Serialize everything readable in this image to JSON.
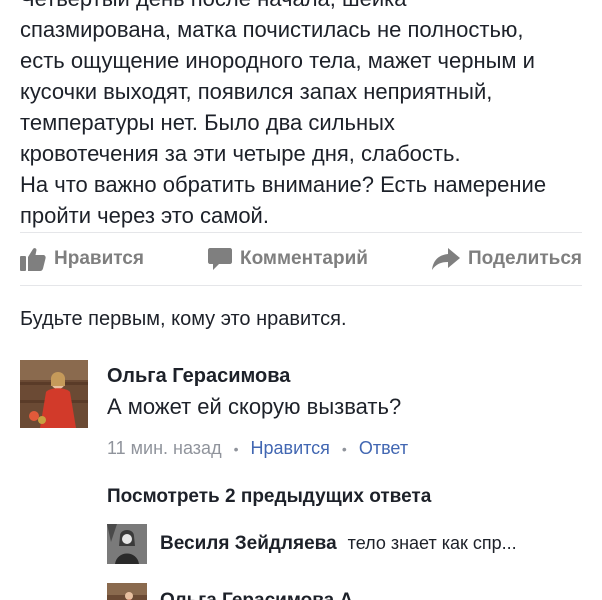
{
  "post": {
    "lines": [
      "Четвертый день после начала, шейка",
      "спазмирована, матка почистилась не полностью,",
      "есть ощущение инородного тела, мажет черным и",
      "кусочки выходят, появился запах неприятный,",
      "температуры нет. Было два сильных",
      "кровотечения за эти четыре дня, слабость.",
      "На что важно обратить внимание? Есть намерение",
      "пройти через это самой."
    ]
  },
  "actions": {
    "like": {
      "label": "Нравится",
      "icon": "thumbs-up-icon"
    },
    "comment": {
      "label": "Комментарий",
      "icon": "comment-bubble-icon"
    },
    "share": {
      "label": "Поделиться",
      "icon": "share-arrow-icon"
    }
  },
  "first_like_text": "Будьте первым, кому это нравится.",
  "comment": {
    "author": "Ольга Герасимова",
    "text": "А может ей скорую вызвать?",
    "time": "11 мин. назад",
    "like_label": "Нравится",
    "reply_label": "Ответ"
  },
  "view_previous_label": "Посмотреть 2 предыдущих ответа",
  "reply": {
    "author": "Весиля Зейдляева",
    "snippet": "тело знает как спр..."
  },
  "reply2": {
    "author": "Ольга Герасимова А"
  },
  "colors": {
    "link": "#4267b2",
    "muted": "#90949c",
    "action_gray": "#7f7f7f",
    "text": "#1d2129"
  }
}
